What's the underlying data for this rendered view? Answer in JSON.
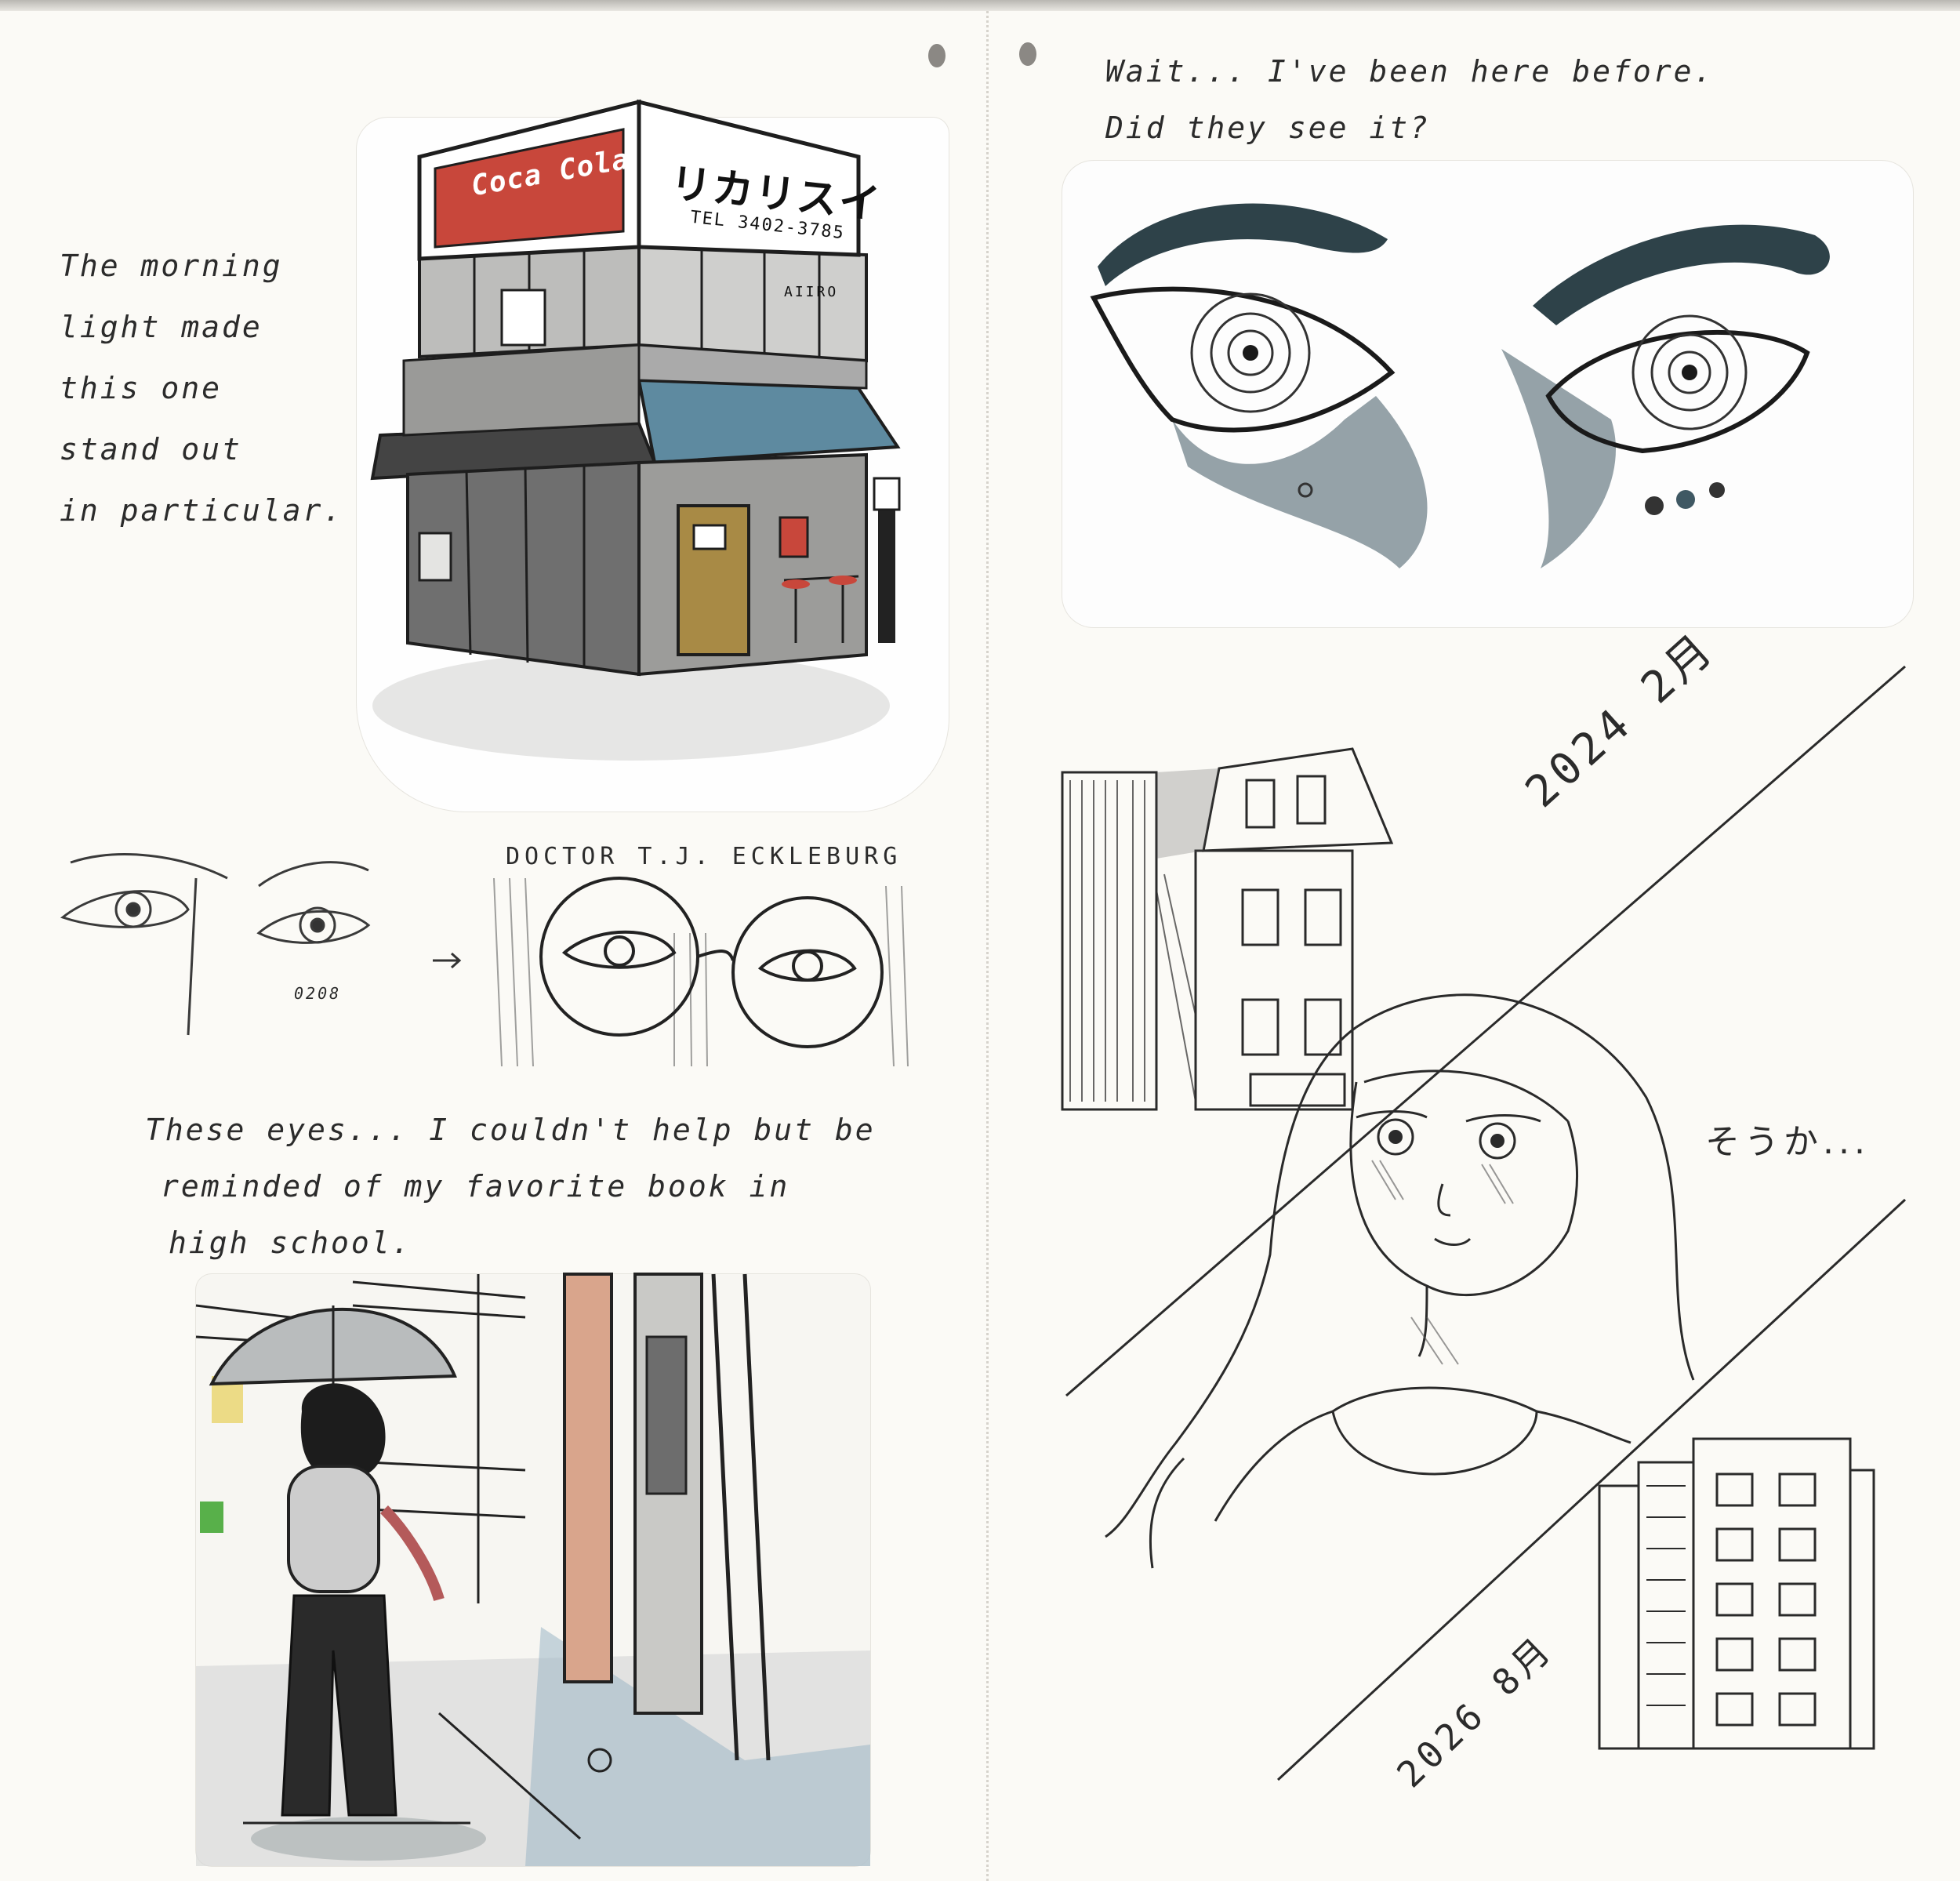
{
  "left_page": {
    "caption_building": [
      "The morning",
      "light made",
      "this one",
      "stand out",
      "in particular."
    ],
    "sign_katakana": "リカリスイ",
    "sign_tel": "TEL 3402-3785",
    "sign_red": "Coca Cola",
    "banner_small": "AIIRO",
    "sketch_label": "DOCTOR T.J. ECKLEBURG",
    "eyes_small_mark": "0208",
    "caption_eyes": [
      "These eyes... I couldn't help but be",
      "reminded of my favorite book in",
      "high school."
    ]
  },
  "right_page": {
    "caption_top": [
      "Wait... I've been here before.",
      "Did they see it?"
    ],
    "date_top": "2024 2月",
    "date_bottom": "2026 8月",
    "exclaim": "そうか..."
  },
  "colors": {
    "paper": "#fbfaf6",
    "ink": "#2b2b2b",
    "wash_gray": "#8e8f8e",
    "awning_blue": "#5e8aa0",
    "sign_red": "#c8473b",
    "door_ochre": "#a88a45",
    "eye_wash": "#3f5863"
  }
}
